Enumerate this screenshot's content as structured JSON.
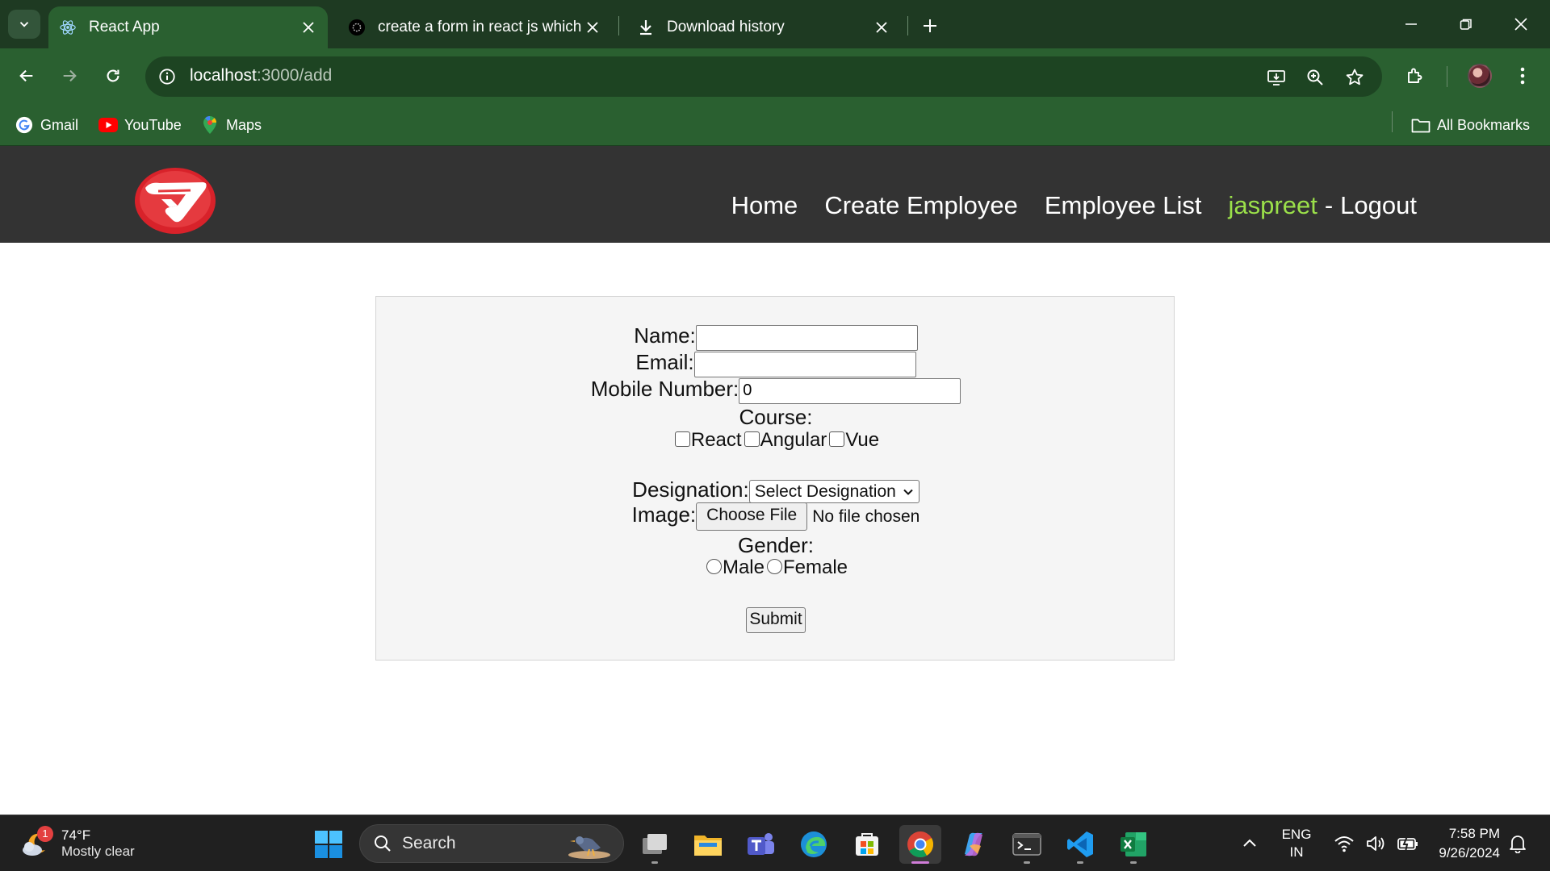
{
  "browser": {
    "tabs": [
      {
        "title": "React App",
        "icon": "react-icon",
        "active": true
      },
      {
        "title": "create a form in react js which i",
        "icon": "openai-icon",
        "active": false
      },
      {
        "title": "Download history",
        "icon": "download-icon",
        "active": false
      }
    ],
    "url_host": "localhost",
    "url_path": ":3000/add",
    "bookmarks": [
      {
        "label": "Gmail",
        "icon": "google-icon"
      },
      {
        "label": "YouTube",
        "icon": "youtube-icon"
      },
      {
        "label": "Maps",
        "icon": "maps-icon"
      }
    ],
    "all_bookmarks_label": "All Bookmarks",
    "theme_color": "#2a6030"
  },
  "navbar": {
    "links": [
      "Home",
      "Create Employee",
      "Employee List"
    ],
    "username": "jaspreet",
    "separator": "-",
    "logout": "Logout",
    "username_color": "#9be04a"
  },
  "form": {
    "name_label": "Name:",
    "name_value": "",
    "email_label": "Email:",
    "email_value": "",
    "mobile_label": "Mobile Number:",
    "mobile_value": "0",
    "course_label": "Course:",
    "courses": [
      "React",
      "Angular",
      "Vue"
    ],
    "designation_label": "Designation:",
    "designation_selected": "Select Designation",
    "image_label": "Image:",
    "file_button": "Choose File",
    "file_status": "No file chosen",
    "gender_label": "Gender:",
    "genders": [
      "Male",
      "Female"
    ],
    "submit_label": "Submit"
  },
  "taskbar": {
    "weather_temp": "74°F",
    "weather_condition": "Mostly clear",
    "weather_badge": "1",
    "search_label": "Search",
    "lang_line1": "ENG",
    "lang_line2": "IN",
    "time": "7:58 PM",
    "date": "9/26/2024"
  }
}
